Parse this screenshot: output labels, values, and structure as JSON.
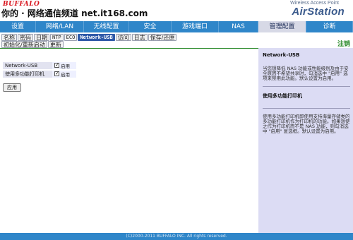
{
  "header": {
    "brand": "BUFFALO",
    "site_caption": "你的 · 网络通信频道 net.it168.com",
    "product_sub": "Wireless Access Point",
    "product": "AirStation"
  },
  "main_nav": [
    "设置",
    "网络/LAN",
    "无线配置",
    "安全",
    "游戏端口",
    "NAS",
    "管理配置",
    "诊断"
  ],
  "sub_nav": {
    "row1": [
      "名称",
      "密码",
      "日期",
      "NTP",
      "ECO",
      "Network-USB",
      "访问",
      "日志",
      "保存/还原"
    ],
    "row2": [
      "初始化/重新启动",
      "更新"
    ],
    "active": "Network-USB"
  },
  "settings": {
    "rows": [
      {
        "label": "Network-USB",
        "checked": "✓",
        "value": "启用"
      },
      {
        "label": "使用多功能打印机",
        "checked": "✓",
        "value": "启用"
      }
    ],
    "apply_label": "应用"
  },
  "sidebar": {
    "note_label": "注销",
    "sections": [
      {
        "title": "Network-USB",
        "body": "当您想降低 NAS 功能或性能级别及由于安全原因不希望共享时，勾消选中 \"启用\" 选项来禁用此功能。默认设置为启用。"
      },
      {
        "title": "使用多功能打印机",
        "body": "使用多功能打印机即使用支持海量存储类的多功能打印机作为打印机的功能。如果想使之作为打印机而不是 NAS 功能，则勾消选中 \"启用\" 复选框。默认设置为启用。"
      }
    ]
  },
  "footer": {
    "text": "(C)2000-2011 BUFFALO INC. All rights reserved."
  },
  "colors": {
    "nav_blue": "#2f86c9",
    "active_tab": "#d7d9e6",
    "sidebar_bg": "#dcdcf4",
    "brand_red": "#d8141c",
    "note_green": "#2a8a2a"
  }
}
